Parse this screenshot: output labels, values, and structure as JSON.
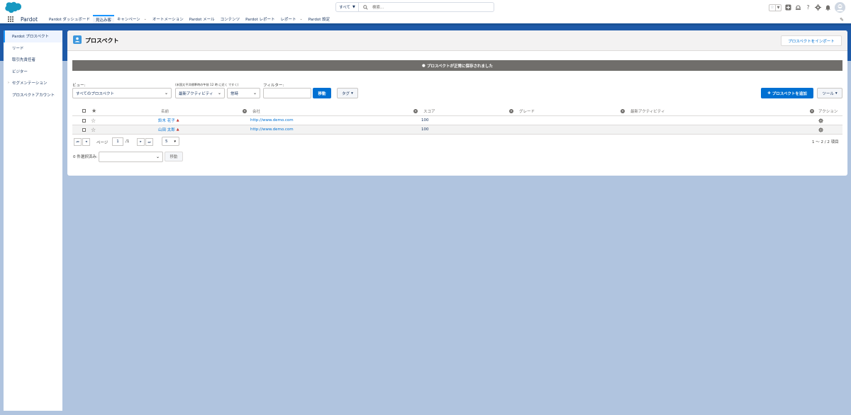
{
  "header": {
    "search_scope": "すべて",
    "search_placeholder": "検索..."
  },
  "nav": {
    "app_name": "Pardot",
    "items": [
      {
        "label": "Pardot ダッシュボード",
        "has_menu": false
      },
      {
        "label": "見込み客",
        "has_menu": false,
        "active": true
      },
      {
        "label": "キャンペーン",
        "has_menu": true
      },
      {
        "label": "オートメーション",
        "has_menu": false
      },
      {
        "label": "Pardot メール",
        "has_menu": false
      },
      {
        "label": "コンテンツ",
        "has_menu": false
      },
      {
        "label": "Pardot レポート",
        "has_menu": false
      },
      {
        "label": "レポート",
        "has_menu": true
      },
      {
        "label": "Pardot 設定",
        "has_menu": false
      }
    ]
  },
  "sidebar": {
    "items": [
      {
        "label": "Pardot プロスペクト",
        "active": true
      },
      {
        "label": "リード"
      },
      {
        "label": "取引先責任者"
      },
      {
        "label": "ビジター"
      },
      {
        "label": "セグメンテーション",
        "expandable": true
      },
      {
        "label": "プロスペクトアカウント"
      }
    ]
  },
  "page": {
    "title": "プロスペクト",
    "import_button": "プロスペクトをインポート",
    "banner": "プロスペクトが正常に保存されました"
  },
  "filters": {
    "view_label": "ビュー:",
    "view_value": "すべてのプロスペクト",
    "activity_label": "(米国太平洋標準時の午前 12 時 に近く ですく)",
    "activity_value": "最新アクティビティ",
    "time_value": "常時",
    "filter_label": "フィルター:",
    "filter_value": "",
    "go_button": "移動",
    "tag_button": "タグ",
    "add_button": "プロスペクトを追加",
    "tools_button": "ツール"
  },
  "table": {
    "columns": {
      "name": "名前",
      "company": "会社",
      "score": "スコア",
      "grade": "グレード",
      "activity": "最新アクティビティ",
      "actions": "アクション"
    },
    "rows": [
      {
        "name": "鈴木 花子",
        "company": "http://www.demo.com",
        "score": "100",
        "grade": "",
        "activity": ""
      },
      {
        "name": "山田 太郎",
        "company": "http://www.demo.com",
        "score": "100",
        "grade": "",
        "activity": ""
      }
    ]
  },
  "pager": {
    "page_label": "ページ",
    "page_value": "1",
    "page_total": "/1",
    "per_page": "5",
    "range": "1 ～ 2 / 2 項目"
  },
  "bulk": {
    "selected_label": "0 件選択済み:",
    "select_value": "",
    "go_button": "移動"
  },
  "colors": {
    "brand": "#0070d2",
    "nav_band": "#1e5aa8",
    "background": "#b0c4df"
  }
}
